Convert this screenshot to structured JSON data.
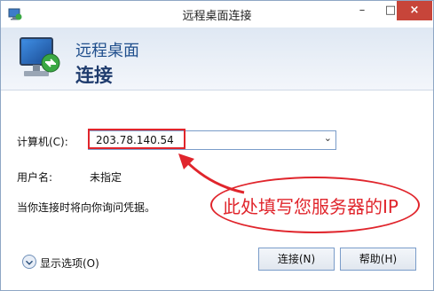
{
  "window": {
    "title": "远程桌面连接",
    "controls": {
      "minimize": "–",
      "maximize": "□",
      "close": "×"
    }
  },
  "header": {
    "line1": "远程桌面",
    "line2": "连接"
  },
  "form": {
    "computer_label": "计算机(C):",
    "computer_value": "203.78.140.54",
    "username_label": "用户名:",
    "username_value": "未指定",
    "info_text": "当你连接时将向你询问凭据。"
  },
  "footer": {
    "show_options": "显示选项(O)",
    "connect_button": "连接(N)",
    "help_button": "帮助(H)"
  },
  "annotation": {
    "callout_text": "此处填写您服务器的IP",
    "color": "#e0252c"
  },
  "icons": [
    "remote-desktop-app-icon",
    "monitor-icon",
    "chevron-down-icon",
    "expand-options-icon"
  ]
}
